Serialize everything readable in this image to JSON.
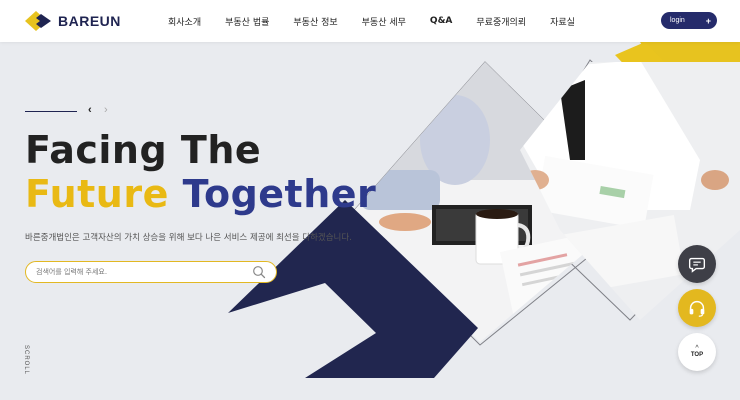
{
  "brand": {
    "name": "BAREUN"
  },
  "nav": {
    "items": [
      "회사소개",
      "부동산 법률",
      "부동산 정보",
      "부동산 세무",
      "Q&A",
      "무료중개의뢰",
      "자료실"
    ]
  },
  "login": {
    "label": "login",
    "icon": "plus-icon"
  },
  "hero": {
    "prev_arrow": "‹",
    "next_arrow": "›",
    "title_line1": "Facing The",
    "title_word_yellow": "Future",
    "title_word_navy": "Together",
    "description": "바른중개법인은 고객자산의 가치 상승을 위해 보다 나은 서비스 제공에 최선을 다하겠습니다."
  },
  "search": {
    "placeholder": "검색어를 입력해 주세요.",
    "value": "",
    "icon": "search-icon"
  },
  "scroll_label": "SCROLL",
  "side_buttons": {
    "chat_icon": "chat-icon",
    "support_icon": "headset-icon",
    "top_label": "TOP"
  },
  "colors": {
    "navy": "#1f2451",
    "yellow": "#e9b914",
    "title_navy": "#2e3a8c",
    "background": "#e9ebef"
  }
}
